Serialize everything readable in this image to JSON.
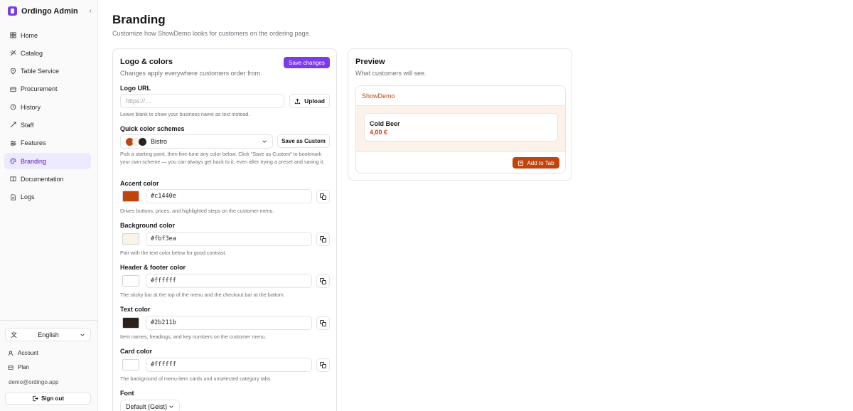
{
  "colors": {
    "brand": "#7c3aed",
    "accent": "#c1440e",
    "background": "#fbf3ea",
    "header_footer": "#ffffff",
    "text": "#2b211b",
    "card": "#ffffff"
  },
  "sidebar": {
    "app_name": "Ordingo Admin",
    "items": [
      {
        "label": "Home",
        "icon": "home-icon"
      },
      {
        "label": "Catalog",
        "icon": "catalog-icon"
      },
      {
        "label": "Table Service",
        "icon": "map-pin-icon"
      },
      {
        "label": "Procurement",
        "icon": "procurement-icon"
      },
      {
        "label": "History",
        "icon": "history-icon"
      },
      {
        "label": "Staff",
        "icon": "staff-icon"
      },
      {
        "label": "Features",
        "icon": "sliders-icon"
      },
      {
        "label": "Branding",
        "icon": "palette-icon",
        "active": true
      },
      {
        "label": "Documentation",
        "icon": "book-icon"
      },
      {
        "label": "Logs",
        "icon": "logs-icon"
      }
    ],
    "language": "English",
    "account_label": "Account",
    "plan_label": "Plan",
    "email": "demo@ordingo.app",
    "sign_out_label": "Sign out"
  },
  "page": {
    "title": "Branding",
    "subtitle": "Customize how ShowDemo looks for customers on the ordering page."
  },
  "logo_card": {
    "title": "Logo & colors",
    "subtitle": "Changes apply everywhere customers order from.",
    "save_label": "Save changes",
    "logo_url": {
      "label": "Logo URL",
      "placeholder": "https://…",
      "upload_label": "Upload",
      "help": "Leave blank to show your business name as text instead."
    },
    "schemes": {
      "label": "Quick color schemes",
      "selected": "Bistro",
      "save_custom_label": "Save as Custom",
      "help": "Pick a starting point, then fine-tune any color below. Click \"Save as Custom\" to bookmark your own scheme — you can always get back to it, even after trying a preset and saving it."
    },
    "fields": [
      {
        "label": "Accent color",
        "value": "#c1440e",
        "help": "Drives buttons, prices, and highlighted steps on the customer menu."
      },
      {
        "label": "Background color",
        "value": "#fbf3ea",
        "help": "Pair with the text color below for good contrast."
      },
      {
        "label": "Header & footer color",
        "value": "#ffffff",
        "help": "The sticky bar at the top of the menu and the checkout bar at the bottom."
      },
      {
        "label": "Text color",
        "value": "#2b211b",
        "help": "Item names, headings, and key numbers on the customer menu."
      },
      {
        "label": "Card color",
        "value": "#ffffff",
        "help": "The background of menu-item cards and unselected category tabs."
      }
    ],
    "font": {
      "label": "Font",
      "selected": "Default (Geist)"
    }
  },
  "preview_card": {
    "title": "Preview",
    "subtitle": "What customers will see.",
    "business_name": "ShowDemo",
    "item_name": "Cold Beer",
    "item_price": "4,00 €",
    "add_button": "Add to Tab"
  }
}
